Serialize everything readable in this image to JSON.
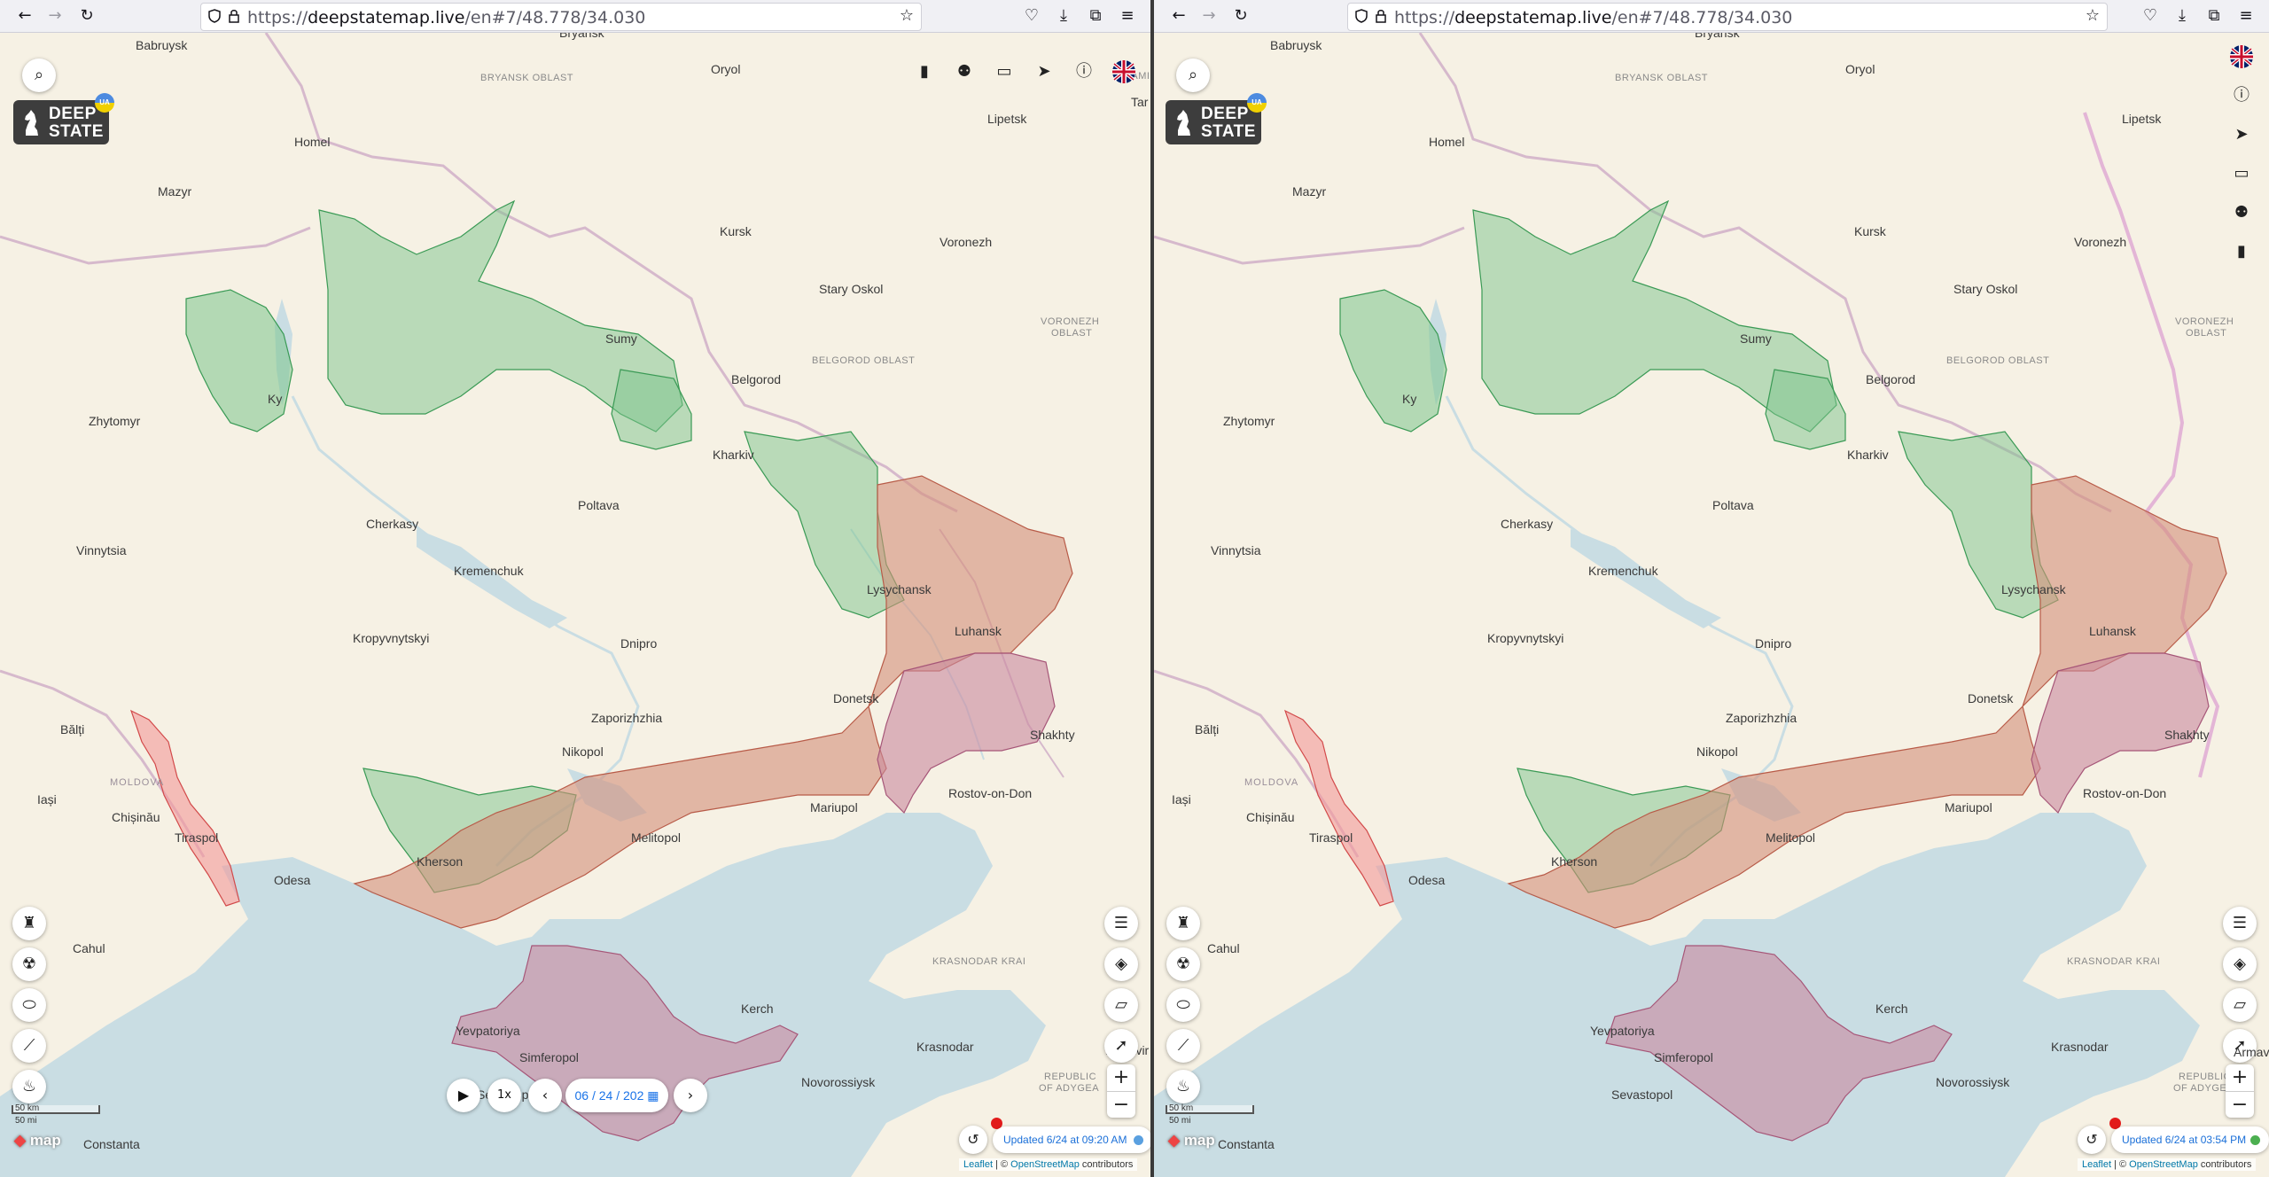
{
  "browser": {
    "url_prefix": "https://",
    "url_host": "deepstatemap.live",
    "url_path": "/en#7/48.778/34.030"
  },
  "logo": {
    "line1": "DEEP",
    "line2": "STATE",
    "badge": "UA"
  },
  "map": {
    "cities": {
      "babruysk": "Babruysk",
      "bryansk": "Bryansk",
      "oryol": "Oryol",
      "lipetsk": "Lipetsk",
      "homel": "Homel",
      "mazyr": "Mazyr",
      "kursk": "Kursk",
      "voronezh": "Voronezh",
      "stary_oskol": "Stary Oskol",
      "sumy": "Sumy",
      "belgorod": "Belgorod",
      "kyiv": "Ky",
      "zhytomyr": "Zhytomyr",
      "kharkiv": "Kharkiv",
      "poltava": "Poltava",
      "cherkasy": "Cherkasy",
      "vinnytsia": "Vinnytsia",
      "kremenchuk": "Kremenchuk",
      "lysychansk": "Lysychansk",
      "kropyvnytskyi": "Kropyvnytskyi",
      "dnipro": "Dnipro",
      "luhansk": "Luhansk",
      "balti": "Bălți",
      "donetsk": "Donetsk",
      "zaporizhzhia": "Zaporizhzhia",
      "shakhty": "Shakhty",
      "iasi": "Iași",
      "nikopol": "Nikopol",
      "chisinau": "Chișinău",
      "mariupol": "Mariupol",
      "rostov": "Rostov-on-Don",
      "tiraspol": "Tiraspol",
      "melitopol": "Melitopol",
      "odesa": "Odesa",
      "kherson": "Kherson",
      "cahul": "Cahul",
      "yevpatoriya": "Yevpatoriya",
      "kerch": "Kerch",
      "simferopol": "Simferopol",
      "krasnodar": "Krasnodar",
      "sevastopol": "Sevastopol",
      "novorossiysk": "Novorossiysk",
      "armavir": "Armavir",
      "constanta": "Constanta",
      "tambov": "Tar"
    },
    "regions": {
      "bryansk_oblast": "BRYANSK OBLAST",
      "voronezh_oblast_1": "VORONEZH",
      "voronezh_oblast_2": "OBLAST",
      "belgorod_oblast": "BELGOROD OBLAST",
      "moldova": "MOLDOVA",
      "krasnodar_krai": "KRASNODAR KRAI",
      "adygea_1": "REPUBLIC",
      "adygea_2": "OF ADYGEA",
      "tambov_region": "TAMI"
    },
    "scale_km": "50 km",
    "scale_mi": "50 mi",
    "attribution": {
      "leaflet": "Leaflet",
      "sep": " | © ",
      "osm": "OpenStreetMap",
      "contributors": " contributors"
    },
    "brand_logo": "map",
    "colors": {
      "occupied": "#d4907a",
      "pre2022_occupied": "#c9889f",
      "liberated": "#7cc48c",
      "transnistria": "#f39a9a",
      "water": "#c9dde3",
      "land": "#f6f1e4"
    }
  },
  "left": {
    "date_value": "06 / 24 / 202",
    "speed_label": "1x",
    "updated_text": "Updated 6/24 at 09:20 AM",
    "updated_dot_color": "#5aa0e0"
  },
  "right": {
    "updated_text": "Updated 6/24 at 03:54 PM",
    "updated_dot_color": "#4caf50"
  }
}
